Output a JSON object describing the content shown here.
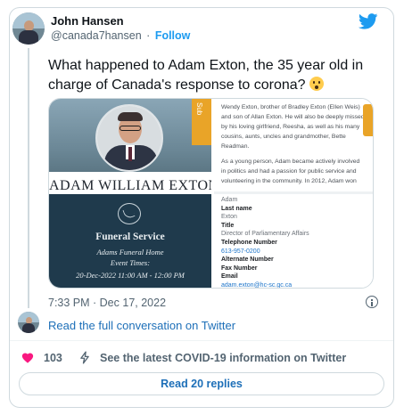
{
  "author": {
    "name": "John Hansen",
    "handle": "@canada7hansen",
    "separator": "·",
    "follow_label": "Follow"
  },
  "tweet": {
    "text": "What happened to Adam Exton, the 35 year old in charge of Canada's response to corona?",
    "timestamp": "7:33 PM · Dec 17, 2022"
  },
  "media": {
    "name_banner": "ADAM WILLIAM EXTON",
    "tab_top": "Sub",
    "funeral": {
      "title": "Funeral Service",
      "home": "Adams Funeral Home",
      "times_label": "Event Times:",
      "date_time": "20-Dec-2022 11:00 AM - 12:00 PM"
    },
    "obituary_p1": "Wendy Exton, brother of Bradley Exton (Ellen Weis) and son of Allan Exton. He will also be deeply missed by his loving girlfriend, Reesha, as well as his many cousins, aunts, uncles and grandmother, Bette Readman.",
    "obituary_p2": "As a young person, Adam became actively involved in politics and had a passion for public service and volunteering in the community. In 2012, Adam won",
    "directory": {
      "first_name": "Adam",
      "last_name_label": "Last name",
      "last_name": "Exton",
      "title_label": "Title",
      "title": "Director of Parliamentary Affairs",
      "phone_label": "Telephone Number",
      "phone": "613-957-0200",
      "alt_label": "Alternate Number",
      "fax_label": "Fax Number",
      "email_label": "Email",
      "email": "adam.exton@hc-sc.gc.ca"
    }
  },
  "footer": {
    "read_conversation": "Read the full conversation on Twitter",
    "likes": "103",
    "covid_link": "See the latest COVID-19 information on Twitter",
    "replies_button": "Read 20 replies"
  },
  "icons": {
    "brand": "twitter-bird-icon",
    "info": "info-icon",
    "like": "heart-icon",
    "covid": "lightning-bolt-icon",
    "reaction": "flushed-face-emoji"
  },
  "colors": {
    "link": "#1d9bf0",
    "heart": "#f91880",
    "brand": "#1d9bf0",
    "accent_gold": "#e9a428"
  }
}
